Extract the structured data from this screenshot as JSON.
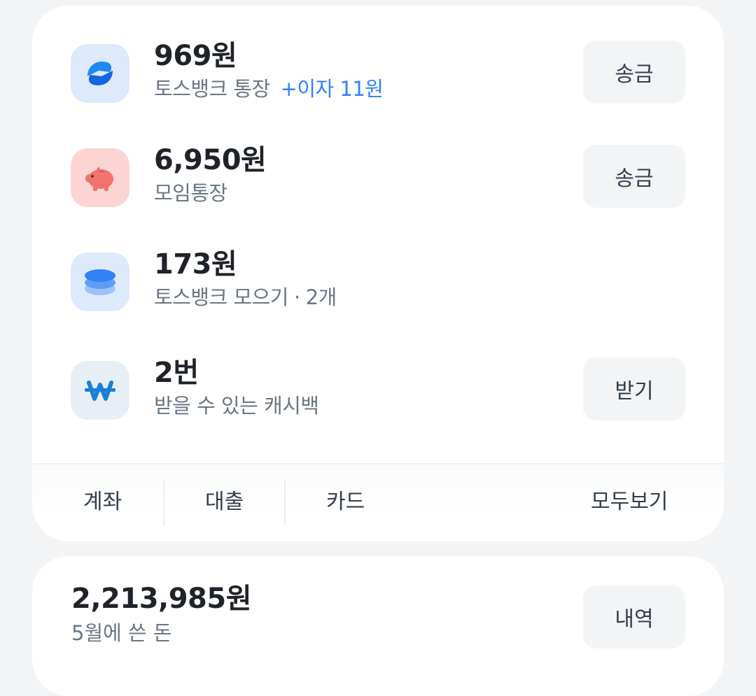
{
  "accounts": [
    {
      "amount": "969원",
      "subtitle": "토스뱅크 통장",
      "interest": "+이자 11원",
      "button": "송금",
      "icon": "toss-bank-icon"
    },
    {
      "amount": "6,950원",
      "subtitle": "모임통장",
      "button": "송금",
      "icon": "piggy-bank-icon"
    },
    {
      "amount": "173원",
      "subtitle": "토스뱅크 모으기",
      "separator": "·",
      "count": "2개",
      "icon": "stacked-coins-icon"
    },
    {
      "amount": "2번",
      "subtitle": "받을 수 있는 캐시백",
      "button": "받기",
      "icon": "won-symbol-icon"
    }
  ],
  "tabs": {
    "account": "계좌",
    "loan": "대출",
    "card": "카드",
    "all": "모두보기"
  },
  "spending": {
    "amount": "2,213,985원",
    "label": "5월에 쓴 돈",
    "button": "내역"
  },
  "colors": {
    "background": "#f2f4f6",
    "card": "#ffffff",
    "accent": "#3182f6",
    "pink_tile": "#fcd4d2",
    "pig": "#f2726e"
  }
}
